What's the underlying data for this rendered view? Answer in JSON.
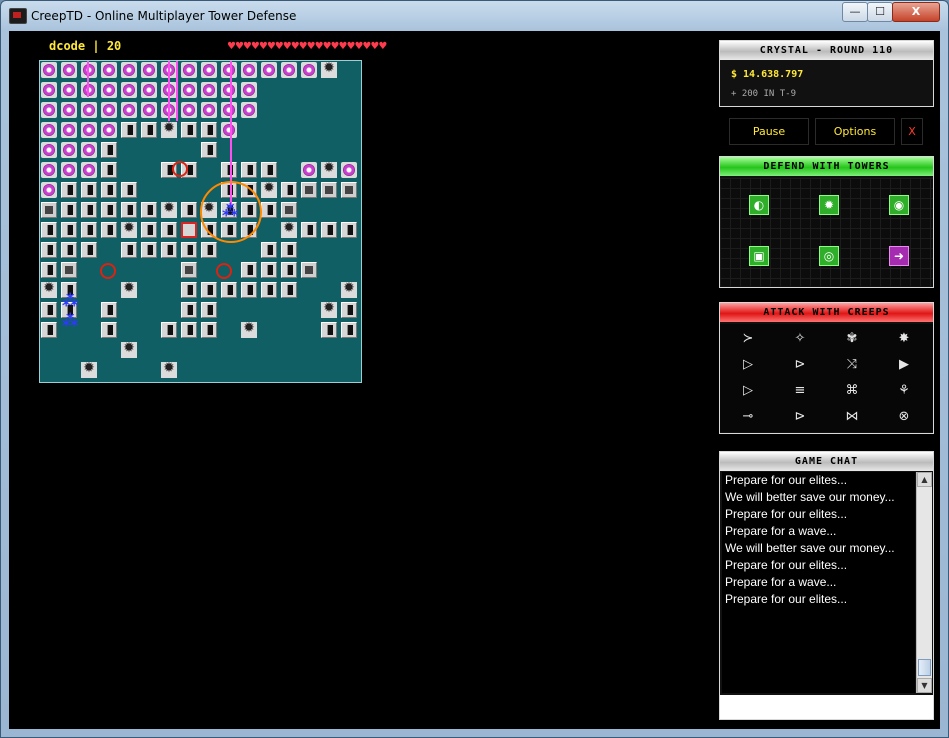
{
  "window": {
    "title": "CreepTD - Online Multiplayer Tower Defense",
    "min_glyph": "—",
    "max_glyph": "☐",
    "close_glyph": "X"
  },
  "player": {
    "name": "dcode",
    "separator": "|",
    "score": "20",
    "hearts": "♥♥♥♥♥♥♥♥♥♥♥♥♥♥♥♥♥♥♥♥"
  },
  "status": {
    "map_round": "CRYSTAL - ROUND 110",
    "money": "$ 14.638.797",
    "income": "+ 200 IN T-9"
  },
  "controls": {
    "pause": "Pause",
    "options": "Options",
    "close": "X"
  },
  "defend": {
    "title": "DEFEND WITH TOWERS",
    "towers": [
      {
        "icon": "pellet-tower-icon",
        "glyph": "◐"
      },
      {
        "icon": "splash-tower-icon",
        "glyph": "✹"
      },
      {
        "icon": "boost-tower-icon",
        "glyph": "◉"
      },
      {
        "icon": "slow-tower-icon",
        "glyph": "▣"
      },
      {
        "icon": "laser-tower-icon",
        "glyph": "◎"
      },
      {
        "icon": "rocket-tower-icon",
        "glyph": "➜"
      }
    ]
  },
  "attack": {
    "title": "ATTACK WITH CREEPS",
    "creeps": [
      {
        "icon": "creep-1-icon",
        "glyph": "≻"
      },
      {
        "icon": "creep-2-icon",
        "glyph": "✧"
      },
      {
        "icon": "creep-3-icon",
        "glyph": "✾"
      },
      {
        "icon": "creep-4-icon",
        "glyph": "✸"
      },
      {
        "icon": "creep-5-icon",
        "glyph": "▷"
      },
      {
        "icon": "creep-6-icon",
        "glyph": "⊳"
      },
      {
        "icon": "creep-7-icon",
        "glyph": "⤨"
      },
      {
        "icon": "creep-8-icon",
        "glyph": "▶"
      },
      {
        "icon": "creep-9-icon",
        "glyph": "▷"
      },
      {
        "icon": "creep-10-icon",
        "glyph": "≡"
      },
      {
        "icon": "creep-11-icon",
        "glyph": "⌘"
      },
      {
        "icon": "creep-12-icon",
        "glyph": "⚘"
      },
      {
        "icon": "creep-13-icon",
        "glyph": "⊸"
      },
      {
        "icon": "creep-14-icon",
        "glyph": "⊳"
      },
      {
        "icon": "creep-15-icon",
        "glyph": "⋈"
      },
      {
        "icon": "creep-16-icon",
        "glyph": "⊗"
      }
    ]
  },
  "chat": {
    "title": "GAME CHAT",
    "messages": [
      "Prepare for our elites...",
      "We will better save our money...",
      "Prepare for our elites...",
      "Prepare for a wave...",
      "We will better save our money...",
      "Prepare for our elites...",
      "Prepare for a wave...",
      "Prepare for our elites..."
    ],
    "input_value": "",
    "scroll_up": "▲",
    "scroll_down": "▼"
  }
}
